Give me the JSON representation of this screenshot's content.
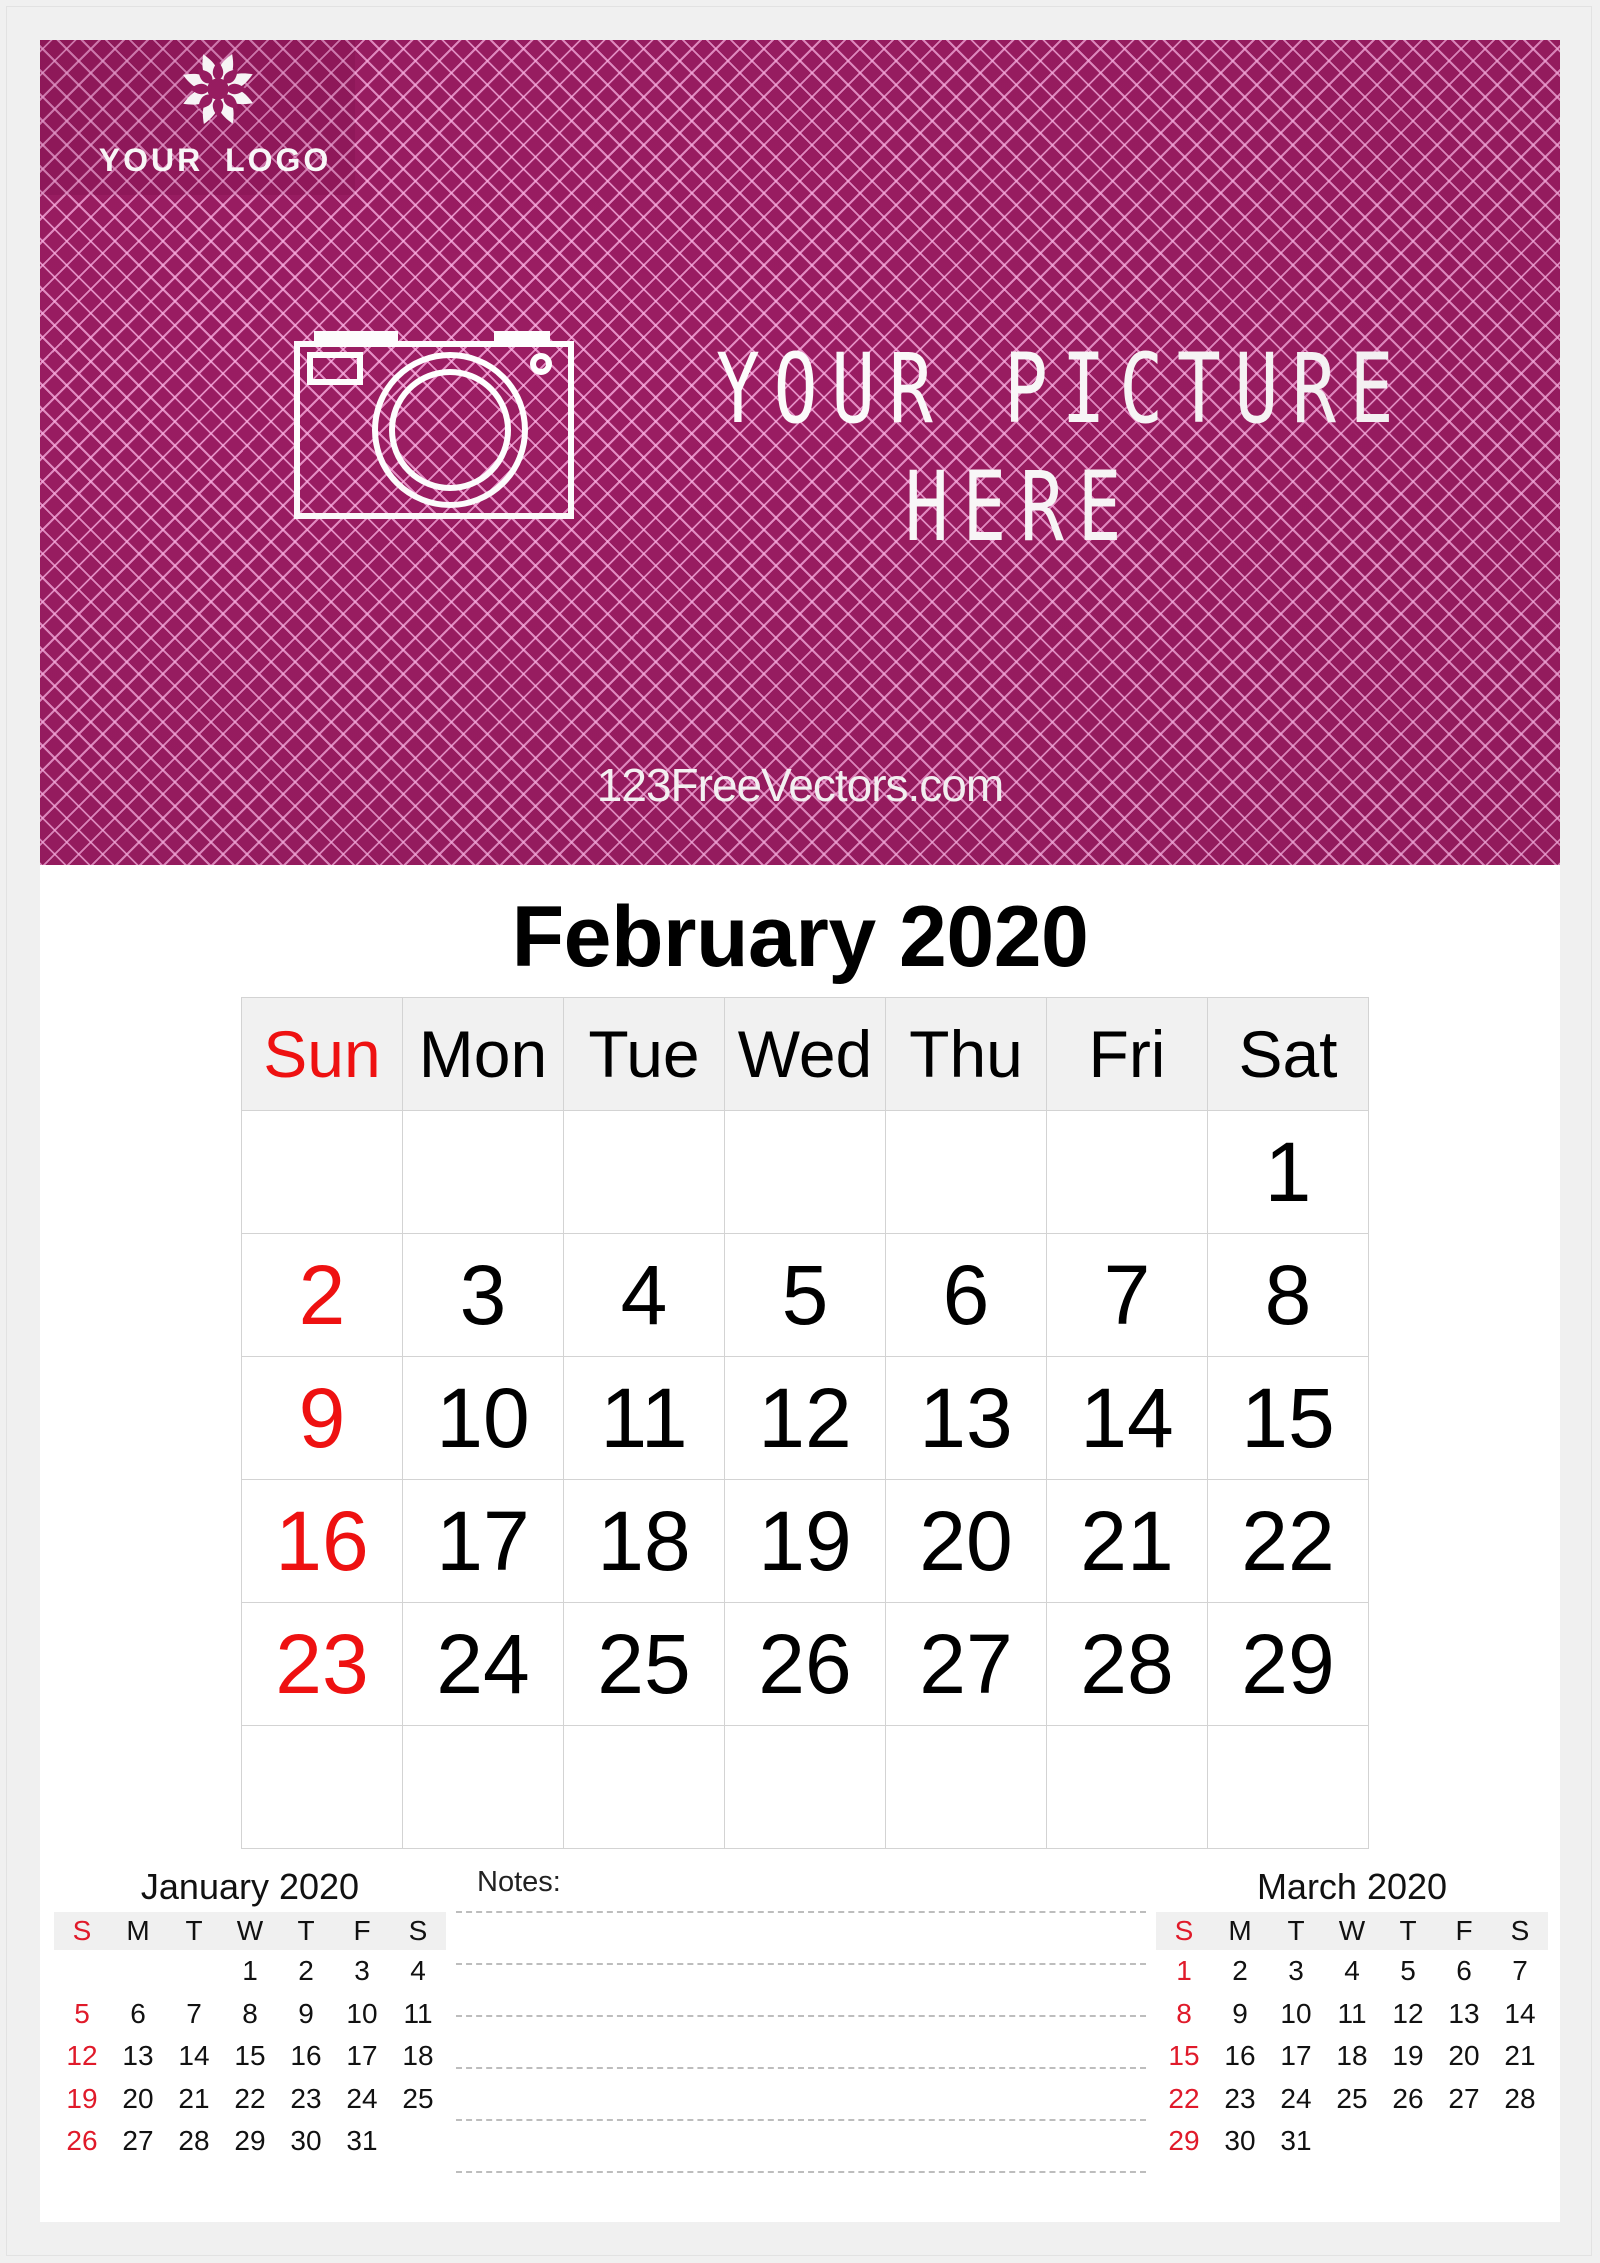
{
  "banner": {
    "logo_text": "YOUR LOGO",
    "picture_text_line1": "YOUR PICTURE",
    "picture_text_line2": "HERE",
    "website": "123FreeVectors.com",
    "background_color": "#9b1d63",
    "icons": [
      "flower-logo-icon",
      "camera-icon"
    ]
  },
  "main_calendar": {
    "title": "February 2020",
    "weekdays": [
      "Sun",
      "Mon",
      "Tue",
      "Wed",
      "Thu",
      "Fri",
      "Sat"
    ],
    "weeks": [
      [
        "",
        "",
        "",
        "",
        "",
        "",
        "1"
      ],
      [
        "2",
        "3",
        "4",
        "5",
        "6",
        "7",
        "8"
      ],
      [
        "9",
        "10",
        "11",
        "12",
        "13",
        "14",
        "15"
      ],
      [
        "16",
        "17",
        "18",
        "19",
        "20",
        "21",
        "22"
      ],
      [
        "23",
        "24",
        "25",
        "26",
        "27",
        "28",
        "29"
      ],
      [
        "",
        "",
        "",
        "",
        "",
        "",
        ""
      ]
    ],
    "sunday_color": "#ee1111",
    "header_bg": "#f1f1f1"
  },
  "prev_month": {
    "title": "January 2020",
    "weekdays": [
      "S",
      "M",
      "T",
      "W",
      "T",
      "F",
      "S"
    ],
    "weeks": [
      [
        "",
        "",
        "",
        "1",
        "2",
        "3",
        "4"
      ],
      [
        "5",
        "6",
        "7",
        "8",
        "9",
        "10",
        "11"
      ],
      [
        "12",
        "13",
        "14",
        "15",
        "16",
        "17",
        "18"
      ],
      [
        "19",
        "20",
        "21",
        "22",
        "23",
        "24",
        "25"
      ],
      [
        "26",
        "27",
        "28",
        "29",
        "30",
        "31",
        ""
      ]
    ]
  },
  "next_month": {
    "title": "March 2020",
    "weekdays": [
      "S",
      "M",
      "T",
      "W",
      "T",
      "F",
      "S"
    ],
    "weeks": [
      [
        "1",
        "2",
        "3",
        "4",
        "5",
        "6",
        "7"
      ],
      [
        "8",
        "9",
        "10",
        "11",
        "12",
        "13",
        "14"
      ],
      [
        "15",
        "16",
        "17",
        "18",
        "19",
        "20",
        "21"
      ],
      [
        "22",
        "23",
        "24",
        "25",
        "26",
        "27",
        "28"
      ],
      [
        "29",
        "30",
        "31",
        "",
        "",
        "",
        ""
      ]
    ]
  },
  "notes": {
    "label": "Notes:",
    "line_count": 6
  }
}
